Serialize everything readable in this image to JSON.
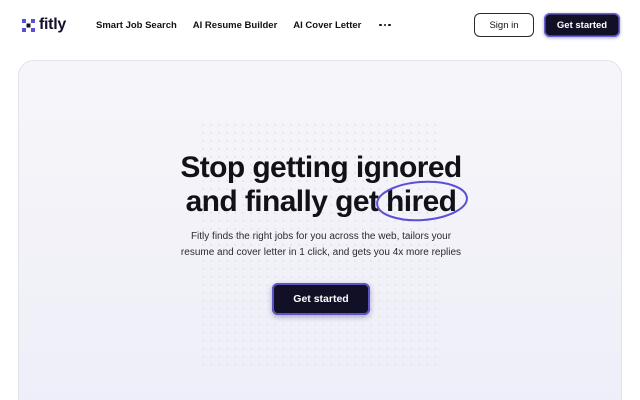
{
  "brand": {
    "name": "fitly",
    "logo_icon": "fitly-logo-icon",
    "accent_color": "#5b4fd6"
  },
  "nav": {
    "items": [
      {
        "label": "Smart Job Search"
      },
      {
        "label": "AI Resume Builder"
      },
      {
        "label": "AI Cover Letter"
      }
    ],
    "more_icon": "more-horizontal-icon"
  },
  "header_actions": {
    "sign_in": "Sign in",
    "get_started": "Get started"
  },
  "hero": {
    "headline_line1": "Stop getting ignored",
    "headline_line2_prefix": "and finally get ",
    "headline_highlight": "hired",
    "subtext_line1": "Fitly finds the right jobs for you across the web, tailors your",
    "subtext_line2": "resume and cover letter in 1 click, and gets you 4x more replies",
    "cta": "Get started"
  }
}
